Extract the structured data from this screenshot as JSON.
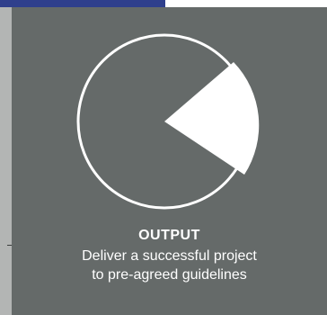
{
  "colors": {
    "header_accent": "#2f3f8c",
    "card_background": "#656a69",
    "side_strip": "#b3b5b4",
    "foreground": "#ffffff"
  },
  "icons": {
    "diagram": "pie-wedge-circle-icon"
  },
  "caption": {
    "title": "OUTPUT",
    "line1": "Deliver a successful project",
    "line2": "to pre-agreed guidelines"
  }
}
